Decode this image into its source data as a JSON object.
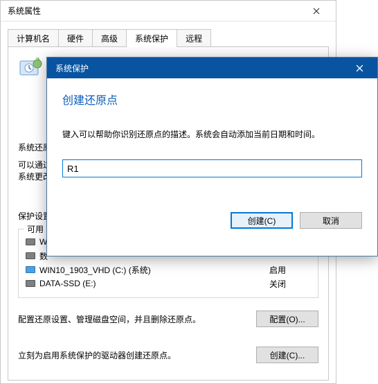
{
  "sysprop": {
    "title": "系统属性",
    "tabs": {
      "computername": "计算机名",
      "hardware": "硬件",
      "advanced": "高级",
      "sysprotect": "系统保护",
      "remote": "远程"
    },
    "heading": "系统还原",
    "desc1": "可以通过",
    "desc2": "系统更改",
    "protection_label": "保护设置",
    "available_label": "可用",
    "drives": [
      {
        "name": "W",
        "status": ""
      },
      {
        "name": "数",
        "status": ""
      },
      {
        "name": "WIN10_1903_VHD (C:) (系统)",
        "status": "启用",
        "blue": true
      },
      {
        "name": "DATA-SSD (E:)",
        "status": "关闭"
      }
    ],
    "config_text": "配置还原设置、管理磁盘空间，并且删除还原点。",
    "config_btn": "配置(O)...",
    "create_text": "立刻为启用系统保护的驱动器创建还原点。",
    "create_btn": "创建(C)..."
  },
  "modal": {
    "title": "系统保护",
    "heading": "创建还原点",
    "desc": "键入可以帮助你识别还原点的描述。系统会自动添加当前日期和时间。",
    "input_value": "R1",
    "create_btn": "创建(C)",
    "cancel_btn": "取消"
  }
}
